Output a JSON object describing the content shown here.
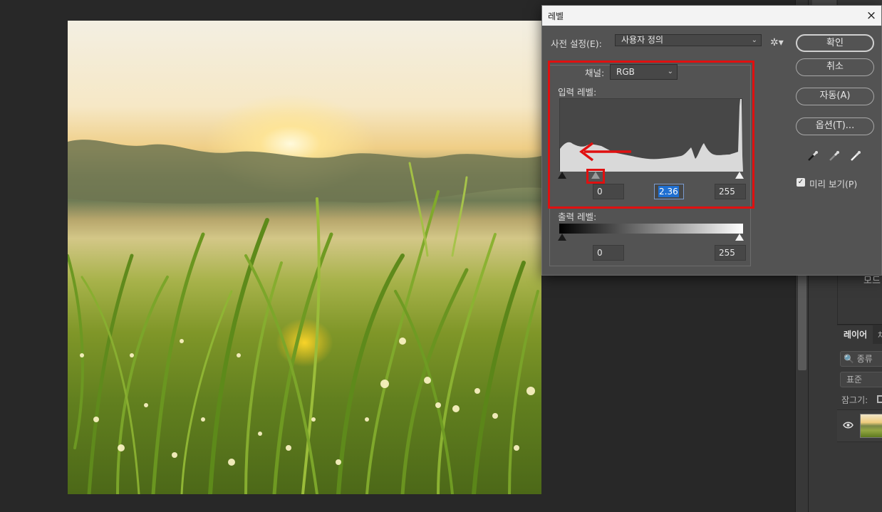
{
  "dialog": {
    "title": "레벨",
    "close_icon": "×",
    "preset_label": "사전 설정(E):",
    "preset_value": "사용자 정의",
    "preset_options_icon": "gear-icon",
    "channel_label": "채널:",
    "channel_value": "RGB",
    "input_levels_label": "입력 레벨:",
    "input_black": "0",
    "input_gamma": "2.36",
    "input_white": "255",
    "output_levels_label": "출력 레벨:",
    "output_black": "0",
    "output_white": "255",
    "buttons": {
      "ok": "확인",
      "cancel": "취소",
      "auto": "자동(A)",
      "options": "옵션(T)..."
    },
    "preview_label": "미리 보기(P)",
    "preview_checked": true,
    "annotation_color": "#e01010"
  },
  "side_panel": {
    "mode_text": "모드",
    "layers_tab": "레이어",
    "layers_tab_second": "채",
    "kind_filter": "🔍 종류",
    "blend_mode": "표준",
    "lock_label": "잠그기:"
  }
}
